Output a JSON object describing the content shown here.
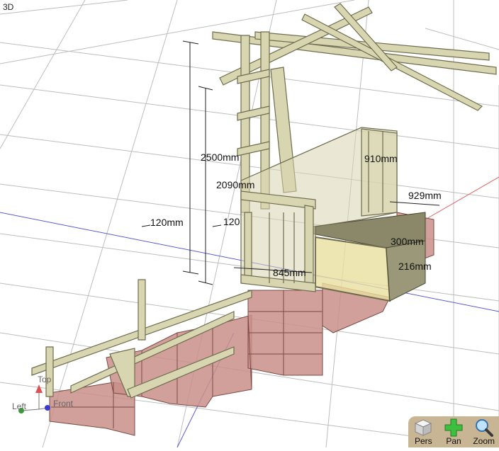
{
  "viewport": {
    "view_label": "3D"
  },
  "dimensions": [
    "2500mm",
    "2090mm",
    "120mm",
    "120",
    "910mm",
    "929mm",
    "300mm",
    "216mm",
    "845mm"
  ],
  "axes": {
    "top": "Top",
    "left": "Left",
    "front": "Front"
  },
  "toolbar": {
    "pers_label": "Pers",
    "pan_label": "Pan",
    "zoom_label": "Zoom"
  },
  "colors": {
    "timber": "#d8d6b0",
    "timber_edge": "#6e6c4e",
    "brick": "#c98f88",
    "brick_edge": "#7a4a44",
    "glass": "#e8e0a0",
    "toolbar": "#c8b593",
    "grid": "#b8b8b8"
  }
}
